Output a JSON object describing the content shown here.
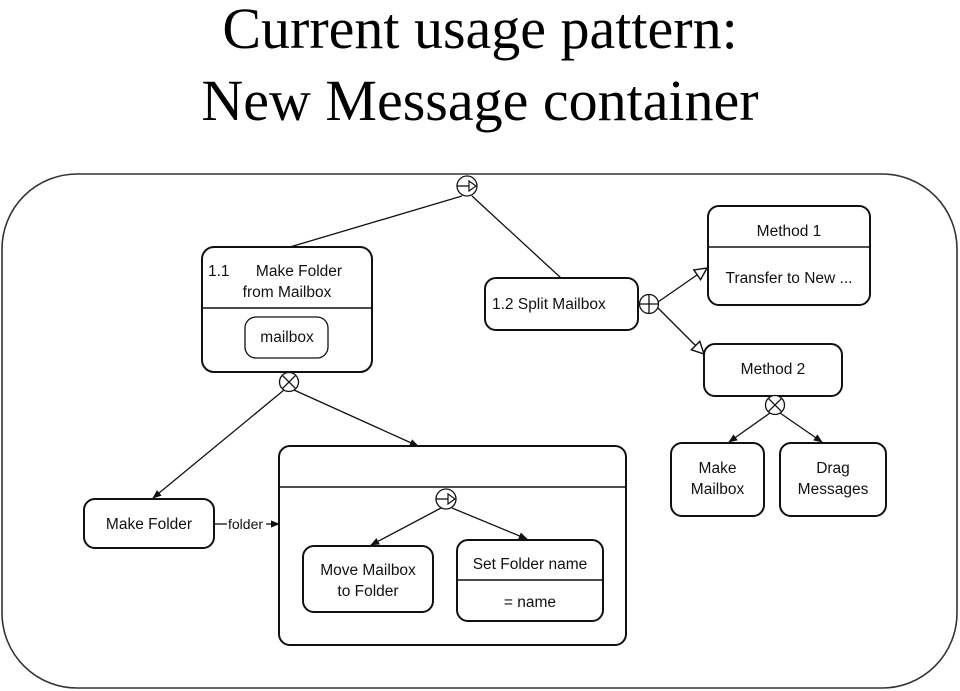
{
  "title": {
    "line1": "Current usage pattern:",
    "line2": "New Message container"
  },
  "connectors": {
    "sequence": "sequence-connector",
    "xor": "xor-connector",
    "and": "and-connector"
  },
  "nodes": {
    "make_folder_from_mailbox": {
      "number": "1.1",
      "title_line1": "Make Folder",
      "title_line2": "from Mailbox",
      "parameter": "mailbox"
    },
    "split_mailbox": {
      "label": "1.2  Split Mailbox"
    },
    "method1": {
      "title": "Method 1",
      "body": "Transfer to New ..."
    },
    "method2": {
      "title": "Method 2"
    },
    "make_mailbox": {
      "line1": "Make",
      "line2": "Mailbox"
    },
    "drag_messages": {
      "line1": "Drag",
      "line2": "Messages"
    },
    "make_folder": {
      "label": "Make Folder"
    },
    "folder_flow_label": "folder",
    "move_mailbox": {
      "line1": "Move Mailbox",
      "line2": "to Folder"
    },
    "set_folder_name": {
      "title": "Set Folder name",
      "body": "= name"
    }
  }
}
